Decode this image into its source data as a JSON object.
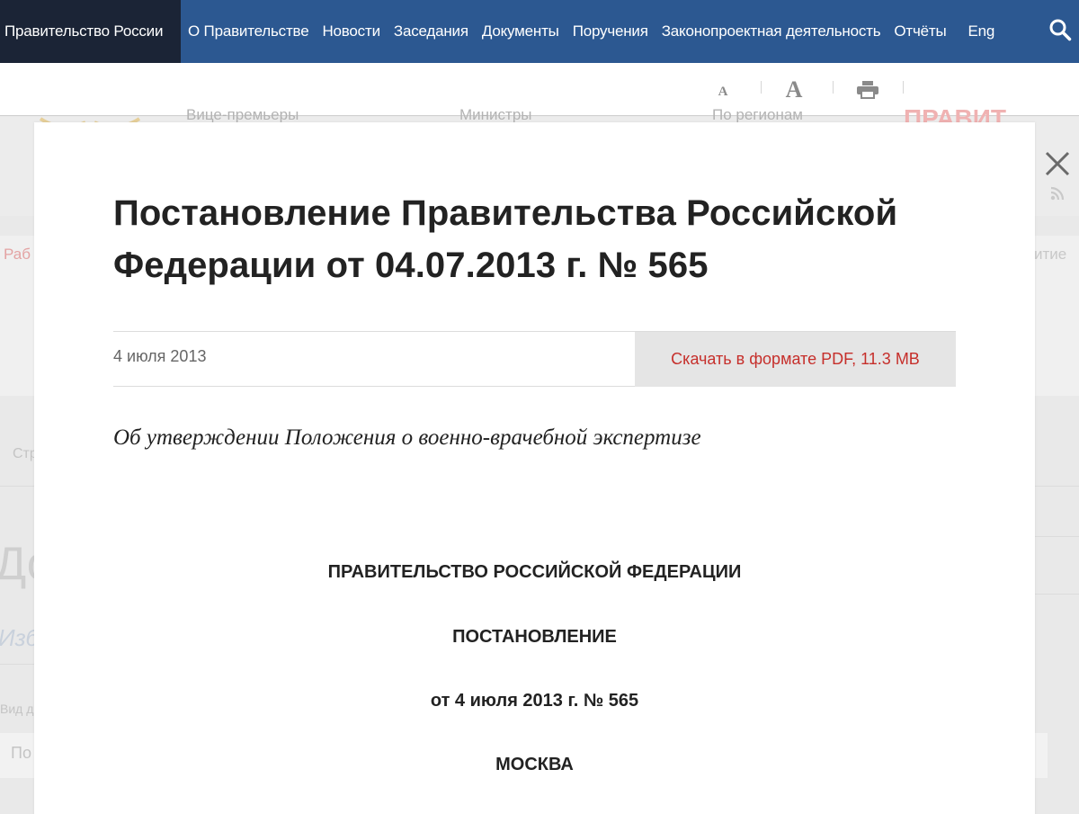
{
  "topnav": {
    "brand": "Правительство России",
    "items": [
      "О Правительстве",
      "Новости",
      "Заседания",
      "Документы",
      "Поручения",
      "Законопроектная деятельность",
      "Отчёты"
    ],
    "lang": "Eng"
  },
  "toolbar": {
    "font_small": "A",
    "font_large": "A"
  },
  "background": {
    "subnav": [
      "Вице-премьеры",
      "Министры",
      "По регионам"
    ],
    "logo_text": "ПРАВИТ",
    "tab_left": "Раб",
    "tab_right": "итие",
    "crumb": "Стр",
    "page_title": "До",
    "favorites": "Изб",
    "kind_label": "Вид д",
    "input_text": "По"
  },
  "modal": {
    "title": "Постановление Правительства Российской Федерации от 04.07.2013 г. № 565",
    "date": "4 июля 2013",
    "pdf_link": "Скачать в формате PDF, 11.3 MB",
    "subject": "Об утверждении Положения о военно-врачебной экспертизе",
    "body": {
      "line1": "ПРАВИТЕЛЬСТВО РОССИЙСКОЙ ФЕДЕРАЦИИ",
      "line2": "ПОСТАНОВЛЕНИЕ",
      "line3": "от 4 июля 2013 г. № 565",
      "line4": "МОСКВА"
    }
  },
  "colors": {
    "nav_bg": "#2c5891",
    "brand_bg": "#1b2436",
    "link_red": "#c62f2b"
  },
  "icons": [
    "search-icon",
    "print-icon",
    "close-icon",
    "rss-icon",
    "emblem-icon"
  ]
}
